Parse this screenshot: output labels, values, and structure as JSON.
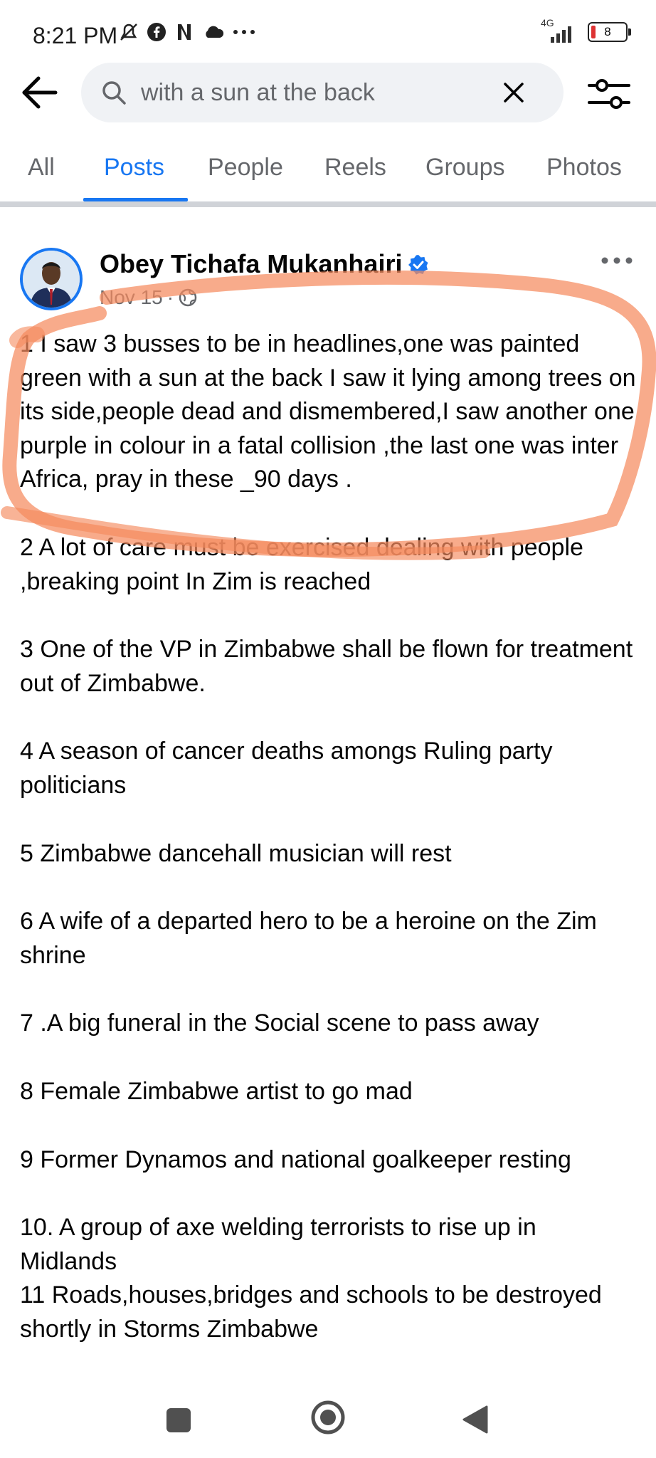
{
  "status_bar": {
    "time": "8:21 PM",
    "icons": [
      "mute-icon",
      "facebook-icon",
      "netflix-icon",
      "cloud-icon",
      "more-dots-icon"
    ],
    "network_label": "4G",
    "battery_level": "8"
  },
  "search": {
    "query": "with a sun at the back"
  },
  "tabs": [
    "All",
    "Posts",
    "People",
    "Reels",
    "Groups",
    "Photos"
  ],
  "active_tab": "Posts",
  "post": {
    "author": "Obey Tichafa Mukanhairi",
    "date": "Nov 15",
    "audience_icon": "globe-icon",
    "items": [
      "1 I saw 3 busses to be in headlines,one was painted green with a sun at the back I saw it lying among trees on its side,people dead and dismembered,I saw another one purple in colour in a fatal collision ,the last one was inter Africa, pray in these _90 days .",
      "2 A lot of care must be exercised dealing with people ,breaking point In Zim is reached",
      "3 One of the VP in Zimbabwe shall be flown for treatment out of Zimbabwe.",
      "4 A season of cancer deaths amongs Ruling party politicians",
      "5 Zimbabwe dancehall musician will rest",
      "6 A wife of a departed hero to be a heroine on the Zim shrine",
      "7 .A big funeral in the Social scene to pass away",
      "8 Female Zimbabwe artist to go mad",
      "9 Former Dynamos and national goalkeeper resting",
      "10. A group of axe welding terrorists to rise up in Midlands",
      "11 Roads,houses,bridges and schools to be destroyed shortly in Storms Zimbabwe"
    ]
  },
  "colors": {
    "accent": "#1877f2",
    "highlight": "#f58a5e",
    "text": "#050505",
    "muted": "#65676b"
  }
}
